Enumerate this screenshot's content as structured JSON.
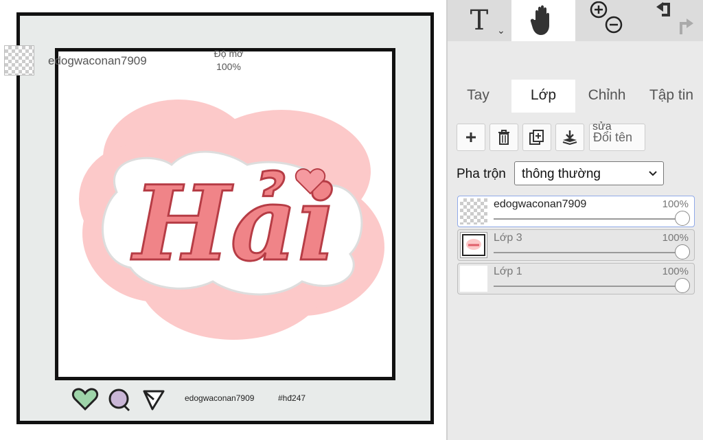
{
  "canvas": {
    "art_text": "Hải",
    "post_user": "edogwaconan7909",
    "post_tag": "#hđ247"
  },
  "toolbar": {
    "icons": [
      "text-tool-icon",
      "hand-tool-icon",
      "zoom-in-icon",
      "zoom-out-icon",
      "undo-icon",
      "redo-icon"
    ]
  },
  "layer_header": {
    "name": "edogwaconan7909",
    "opacity_label": "Độ mờ",
    "opacity_value": "100%"
  },
  "tabs": [
    {
      "label": "Tay"
    },
    {
      "label": "Lớp"
    },
    {
      "label": "Chỉnh sửa"
    },
    {
      "label": "Tập tin"
    }
  ],
  "layer_buttons": {
    "rename_label": "Đổi tên",
    "rename_edit_overlay": "sửa"
  },
  "blend": {
    "label": "Pha trộn",
    "value": "thông thường"
  },
  "layers": [
    {
      "name": "edogwaconan7909",
      "opacity": "100%"
    },
    {
      "name": "Lớp 3",
      "opacity": "100%"
    },
    {
      "name": "Lớp 1",
      "opacity": "100%"
    }
  ],
  "colors": {
    "panel_bg": "#eaeaea",
    "active_tab_bg": "#ffffff",
    "frame_border": "#111111",
    "art_pink": "#f08488",
    "cloud_pink": "#fcc9c9"
  }
}
